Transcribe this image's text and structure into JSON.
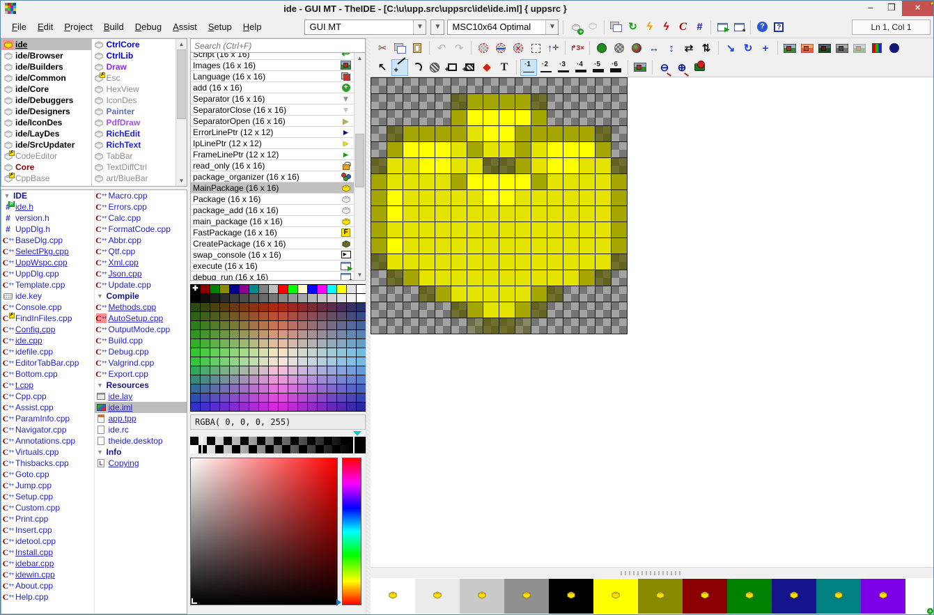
{
  "window": {
    "title": "ide - GUI MT - TheIDE - [C:\\u\\upp.src\\uppsrc\\ide\\ide.iml] { uppsrc }",
    "minimize": "–",
    "maximize": "❒",
    "close": "×"
  },
  "menubar": {
    "menus": [
      "File",
      "Edit",
      "Project",
      "Build",
      "Debug",
      "Assist",
      "Setup",
      "Help"
    ],
    "combo_main": "GUI MT",
    "combo_build": "MSC10x64 Optimal",
    "status": "Ln 1, Col 1",
    "icons": [
      "package-add",
      "package-gray",
      "sep",
      "copy-files",
      "refresh",
      "bolt-yellow",
      "bolt-red",
      "c-lang",
      "hash",
      "sep",
      "run",
      "debug-window",
      "sep",
      "help-circle",
      "help-box"
    ]
  },
  "packages": {
    "col1": [
      {
        "label": "ide",
        "brick": "yellow",
        "selected": true,
        "underline": true,
        "bold": true,
        "color": "#000000",
        "icon_bg": true
      },
      {
        "label": "ide/Browser",
        "brick": "white",
        "bold": true,
        "color": "#000000"
      },
      {
        "label": "ide/Builders",
        "brick": "white",
        "bold": true,
        "color": "#000000"
      },
      {
        "label": "ide/Common",
        "brick": "white",
        "bold": true,
        "color": "#000000"
      },
      {
        "label": "ide/Core",
        "brick": "white",
        "bold": true,
        "color": "#000000"
      },
      {
        "label": "ide/Debuggers",
        "brick": "white",
        "bold": true,
        "color": "#000000"
      },
      {
        "label": "ide/Designers",
        "brick": "white",
        "bold": true,
        "color": "#000000"
      },
      {
        "label": "ide/IconDes",
        "brick": "white",
        "bold": true,
        "color": "#000000"
      },
      {
        "label": "ide/LayDes",
        "brick": "white",
        "bold": true,
        "color": "#000000"
      },
      {
        "label": "ide/SrcUpdater",
        "brick": "white",
        "bold": true,
        "color": "#000000"
      },
      {
        "label": "CodeEditor",
        "brick": "white",
        "badge": "F",
        "color": "#8c8c8c"
      },
      {
        "label": "Core",
        "brick": "white",
        "bold": true,
        "color": "#8b0000"
      },
      {
        "label": "CppBase",
        "brick": "white",
        "badge": "F",
        "color": "#8c8c8c"
      }
    ],
    "col2": [
      {
        "label": "CtrlCore",
        "brick": "white",
        "bold": true,
        "color": "#0000cd"
      },
      {
        "label": "CtrlLib",
        "brick": "white",
        "bold": true,
        "color": "#0000cd"
      },
      {
        "label": "Draw",
        "brick": "white",
        "bold": true,
        "color": "#8a2be2"
      },
      {
        "label": "Esc",
        "brick": "white",
        "badge": "F",
        "color": "#8c8c8c"
      },
      {
        "label": "HexView",
        "brick": "white",
        "color": "#8c8c8c"
      },
      {
        "label": "IconDes",
        "brick": "white",
        "color": "#8c8c8c"
      },
      {
        "label": "Painter",
        "brick": "white",
        "bold": true,
        "color": "#5f6fae"
      },
      {
        "label": "PdfDraw",
        "brick": "white",
        "bold": true,
        "color": "#a050f0"
      },
      {
        "label": "RichEdit",
        "brick": "white",
        "bold": true,
        "color": "#2020dc"
      },
      {
        "label": "RichText",
        "brick": "white",
        "bold": true,
        "color": "#2020dc"
      },
      {
        "label": "TabBar",
        "brick": "white",
        "color": "#8c8c8c"
      },
      {
        "label": "TextDiffCtrl",
        "brick": "white",
        "color": "#8c8c8c"
      },
      {
        "label": "art/BlueBar",
        "brick": "white",
        "color": "#8c8c8c"
      }
    ]
  },
  "files": {
    "col1": [
      {
        "label": "IDE",
        "type": "group"
      },
      {
        "label": "ide.h",
        "type": "h",
        "underline": true,
        "badge": "P"
      },
      {
        "label": "version.h",
        "type": "h"
      },
      {
        "label": "UppDlg.h",
        "type": "h"
      },
      {
        "label": "BaseDlg.cpp",
        "type": "cpp"
      },
      {
        "label": "SelectPkg.cpp",
        "type": "cpp",
        "underline": true
      },
      {
        "label": "UppWspc.cpp",
        "type": "cpp",
        "underline": true
      },
      {
        "label": "UppDlg.cpp",
        "type": "cpp"
      },
      {
        "label": "Template.cpp",
        "type": "cpp"
      },
      {
        "label": "ide.key",
        "type": "key"
      },
      {
        "label": "Console.cpp",
        "type": "cpp"
      },
      {
        "label": "FindInFiles.cpp",
        "type": "cpp",
        "badge": "F"
      },
      {
        "label": "Config.cpp",
        "type": "cpp",
        "underline": true
      },
      {
        "label": "ide.cpp",
        "type": "cpp",
        "underline": true
      },
      {
        "label": "idefile.cpp",
        "type": "cpp"
      },
      {
        "label": "EditorTabBar.cpp",
        "type": "cpp"
      },
      {
        "label": "Bottom.cpp",
        "type": "cpp"
      },
      {
        "label": "t.cpp",
        "type": "cpp",
        "underline": true
      },
      {
        "label": "Cpp.cpp",
        "type": "cpp"
      },
      {
        "label": "Assist.cpp",
        "type": "cpp"
      },
      {
        "label": "ParamInfo.cpp",
        "type": "cpp"
      },
      {
        "label": "Navigator.cpp",
        "type": "cpp"
      },
      {
        "label": "Annotations.cpp",
        "type": "cpp"
      },
      {
        "label": "Virtuals.cpp",
        "type": "cpp"
      },
      {
        "label": "Thisbacks.cpp",
        "type": "cpp"
      },
      {
        "label": "Goto.cpp",
        "type": "cpp"
      },
      {
        "label": "Jump.cpp",
        "type": "cpp"
      },
      {
        "label": "Setup.cpp",
        "type": "cpp"
      },
      {
        "label": "Custom.cpp",
        "type": "cpp"
      },
      {
        "label": "Print.cpp",
        "type": "cpp"
      },
      {
        "label": "Insert.cpp",
        "type": "cpp"
      },
      {
        "label": "idetool.cpp",
        "type": "cpp"
      },
      {
        "label": "Install.cpp",
        "type": "cpp",
        "underline": true
      },
      {
        "label": "idebar.cpp",
        "type": "cpp",
        "underline": true
      },
      {
        "label": "idewin.cpp",
        "type": "cpp",
        "underline": true
      },
      {
        "label": "About.cpp",
        "type": "cpp"
      },
      {
        "label": "Help.cpp",
        "type": "cpp"
      }
    ],
    "col2": [
      {
        "label": "Macro.cpp",
        "type": "cpp"
      },
      {
        "label": "Errors.cpp",
        "type": "cpp"
      },
      {
        "label": "Calc.cpp",
        "type": "cpp"
      },
      {
        "label": "FormatCode.cpp",
        "type": "cpp"
      },
      {
        "label": "Abbr.cpp",
        "type": "cpp"
      },
      {
        "label": "Qtf.cpp",
        "type": "cpp"
      },
      {
        "label": "Xml.cpp",
        "type": "cpp",
        "underline": true
      },
      {
        "label": "Json.cpp",
        "type": "cpp",
        "underline": true
      },
      {
        "label": "Update.cpp",
        "type": "cpp"
      },
      {
        "label": "Compile",
        "type": "group"
      },
      {
        "label": "Methods.cpp",
        "type": "cpp",
        "underline": true
      },
      {
        "label": "AutoSetup.cpp",
        "type": "cpp",
        "underline": true,
        "highlight": true
      },
      {
        "label": "OutputMode.cpp",
        "type": "cpp"
      },
      {
        "label": "Build.cpp",
        "type": "cpp"
      },
      {
        "label": "Debug.cpp",
        "type": "cpp"
      },
      {
        "label": "Valgrind.cpp",
        "type": "cpp"
      },
      {
        "label": "Export.cpp",
        "type": "cpp"
      },
      {
        "label": "Resources",
        "type": "group"
      },
      {
        "label": "ide.lay",
        "type": "lay",
        "underline": true
      },
      {
        "label": "ide.iml",
        "type": "iml",
        "underline": true,
        "selected": true
      },
      {
        "label": "app.tpp",
        "type": "tpp",
        "underline": true
      },
      {
        "label": "ide.rc",
        "type": "doc"
      },
      {
        "label": "theide.desktop",
        "type": "doc"
      },
      {
        "label": "Info",
        "type": "group"
      },
      {
        "label": "Copying",
        "type": "copy",
        "underline": true
      }
    ]
  },
  "icon_list": {
    "search_placeholder": "Search (Ctrl+F)",
    "items": [
      {
        "label": "Script (16 x 16)",
        "icon": "script"
      },
      {
        "label": "Images (16 x 16)",
        "icon": "images"
      },
      {
        "label": "Language (16 x 16)",
        "icon": "language"
      },
      {
        "label": "add (16 x 16)",
        "icon": "add"
      },
      {
        "label": "Separator (16 x 16)",
        "icon": "sep-down"
      },
      {
        "label": "SeparatorClose (16 x 16)",
        "icon": "sep-close"
      },
      {
        "label": "SeparatorOpen (16 x 16)",
        "icon": "sep-open"
      },
      {
        "label": "ErrorLinePtr (12 x 12)",
        "icon": "ptr-navy"
      },
      {
        "label": "IpLinePtr (12 x 12)",
        "icon": "ptr-yellow"
      },
      {
        "label": "FrameLinePtr (12 x 12)",
        "icon": "ptr-green"
      },
      {
        "label": "read_only (16 x 16)",
        "icon": "lock"
      },
      {
        "label": "package_organizer (16 x 16)",
        "icon": "pkg-organizer"
      },
      {
        "label": "MainPackage (16 x 16)",
        "icon": "brick-yellow",
        "selected": true
      },
      {
        "label": "Package (16 x 16)",
        "icon": "brick-white"
      },
      {
        "label": "package_add (16 x 16)",
        "icon": "brick-addb"
      },
      {
        "label": "main_package (16 x 16)",
        "icon": "brick-main"
      },
      {
        "label": "FastPackage (16 x 16)",
        "icon": "flag-f"
      },
      {
        "label": "CreatePackage (16 x 16)",
        "icon": "brick-create"
      },
      {
        "label": "swap_console (16 x 16)",
        "icon": "console"
      },
      {
        "label": "execute (16 x 16)",
        "icon": "execute"
      },
      {
        "label": "debug_run (16 x 16)",
        "icon": "debug-window"
      }
    ]
  },
  "palette": {
    "row1": [
      "#000000",
      "#8b0000",
      "#008000",
      "#8b8b00",
      "#00008b",
      "#8b008b",
      "#008b8b",
      "#808080",
      "#c0c0c0",
      "#ff0000",
      "#00ff00",
      "#ffffc8",
      "#0000ff",
      "#ff00ff",
      "#00ffff",
      "#ffff00",
      "#e4e4e4",
      "#ffffff"
    ],
    "matrix_anchors": {
      "tl": "#2a4a10",
      "tm": "#b42810",
      "tr": "#283070",
      "ml": "#35d435",
      "mm": "#fff8dc",
      "mr": "#7cc8e8",
      "bl": "#3030cc",
      "bm": "#e028e0",
      "br": "#2828a8"
    },
    "rgba_label": "RGBA(   0,    0,    0, 255)"
  },
  "editor": {
    "toolbar1": [
      "cut",
      "copy",
      "paste",
      "sep",
      "undo",
      "redo",
      "sep",
      "sel-ellipse",
      "sel-mask",
      "sel-none",
      "sel-rect",
      "pan",
      "sep",
      "resize-3x",
      "sep",
      "ball-green",
      "ball-alpha",
      "ball-multi",
      "move-h",
      "move-v",
      "flip-h",
      "flip-v",
      "sep",
      "resize-img",
      "rotate-img",
      "axes",
      "sep",
      "pic-normal",
      "pic-red",
      "pic-dark",
      "pic-gray",
      "pic-faded",
      "rgb-bars",
      "ball-navy"
    ],
    "toolbar2": [
      "select-cursor",
      "line",
      "arc",
      "blob",
      "rect",
      "rect-fill",
      "diamond",
      "text",
      "sep",
      "width-1",
      "width-2",
      "width-3",
      "width-4",
      "width-5",
      "width-6",
      "sep",
      "pic-paste",
      "sep",
      "zoom-out",
      "zoom-in",
      "shape-red"
    ],
    "selected_tools": [
      "line",
      "width-1"
    ],
    "grid": {
      "rows": [
        "................",
        ".....dooood.....",
        ".....oYYYYo.....",
        ".dooooyYYoooood.",
        ".oYYYyoyyoyYYYo.",
        "dyyYYyyddoyYYyyd",
        "oyyyyoYYYYoyyyyo",
        "oYyyyyyYYyyyyyyo",
        "oYyyyyyyyyyyyyyo",
        "oyyyyyyyyyyyyyyo",
        "oYyyyyyyyyyyyyyo",
        "dyyyyyyyyyyyyyyd",
        ".doyyyyyyyyyyod.",
        "...doyyyyyod....",
        ".....doyyod.....",
        "......DddD......"
      ],
      "colors": {
        "Y": "#ffff00",
        "y": "#e4e400",
        "o": "#a6a600",
        "d": "rgba(92,92,0,0.72)",
        "D": "rgba(92,92,0,0.38)"
      }
    },
    "previews": [
      "#ffffff",
      "#ebebeb",
      "#c9c9c9",
      "#8f8f8f",
      "#000000",
      "#ffff00",
      "#8a8a00",
      "#8b0000",
      "#008000",
      "#14148c",
      "#008080",
      "#7c00e8"
    ]
  }
}
